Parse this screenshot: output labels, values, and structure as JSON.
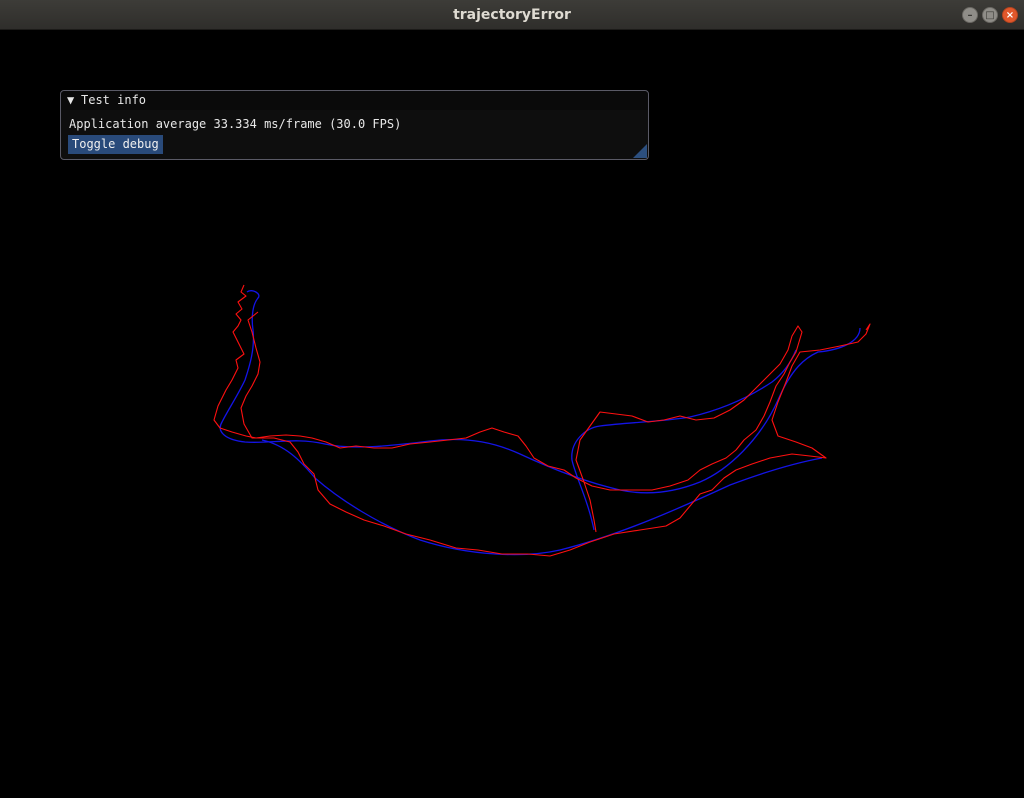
{
  "window": {
    "title": "trajectoryError",
    "controls": {
      "minimize": "–",
      "maximize": "□",
      "close": "×"
    }
  },
  "panel": {
    "title": "Test info",
    "collapse_glyph": "▼",
    "info": "Application average 33.334 ms/frame (30.0 FPS)",
    "toggle_label": "Toggle debug"
  },
  "trajectories": {
    "ground_truth_color": "#1414e6",
    "estimate_color": "#ff1010"
  }
}
